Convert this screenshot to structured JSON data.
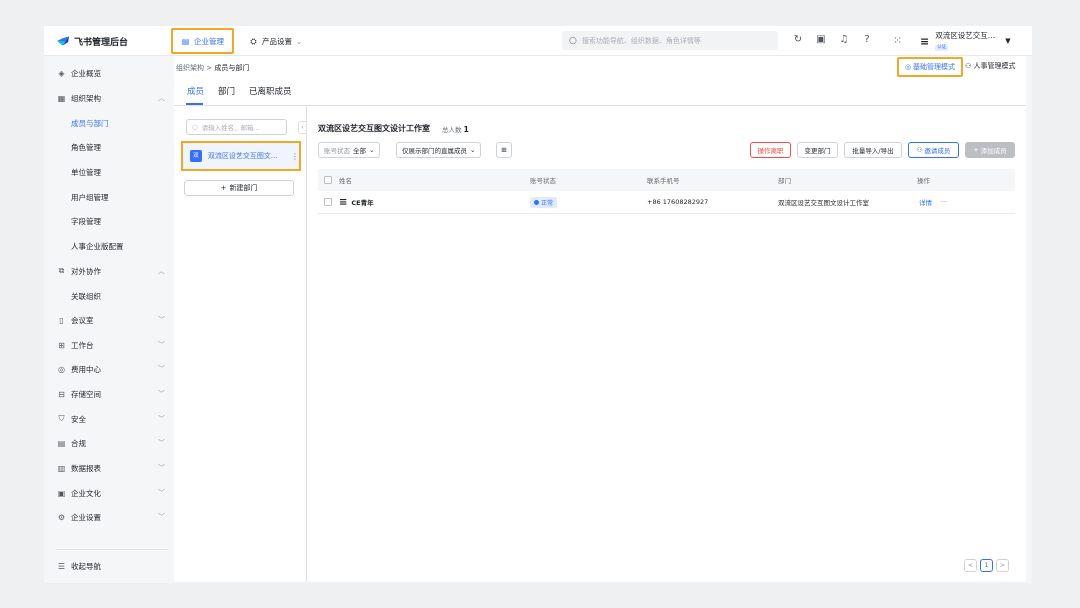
{
  "topbar": {
    "brand": "飞书管理后台",
    "nav_active": "企业管理",
    "nav_product": "产品设置",
    "search_placeholder": "搜索功能导航、组织数据、角色详情等",
    "org_name": "双流区设艺交互…",
    "org_badge": "认证",
    "icons": [
      "refresh-icon",
      "doc-icon",
      "bell-icon",
      "help-icon",
      "apps-grid-icon"
    ]
  },
  "sidebar": {
    "items": [
      {
        "label": "企业概览"
      },
      {
        "label": "组织架构"
      },
      {
        "label": "成员与部门"
      },
      {
        "label": "角色管理"
      },
      {
        "label": "单位管理"
      },
      {
        "label": "用户组管理"
      },
      {
        "label": "字段管理"
      },
      {
        "label": "人事企业版配置"
      },
      {
        "label": "对外协作"
      },
      {
        "label": "关联组织"
      },
      {
        "label": "会议室"
      },
      {
        "label": "工作台"
      },
      {
        "label": "费用中心"
      },
      {
        "label": "存储空间"
      },
      {
        "label": "安全"
      },
      {
        "label": "合规"
      },
      {
        "label": "数据报表"
      },
      {
        "label": "企业文化"
      },
      {
        "label": "企业设置"
      }
    ],
    "collapse_label": "收起导航"
  },
  "breadcrumb": {
    "parent": "组织架构",
    "sep": ">",
    "current": "成员与部门"
  },
  "modes": {
    "basic": "基础管理模式",
    "hr": "人事管理模式"
  },
  "tabs": [
    "成员",
    "部门",
    "已离职成员"
  ],
  "dept_panel": {
    "search_placeholder": "请输入姓名、邮箱...",
    "selected_dept": "双流区设艺交互图文...",
    "dept_avatar": "双",
    "new_dept": "新建部门"
  },
  "content": {
    "title": "双流区设艺交互图文设计工作室",
    "total_label": "总人数",
    "total": "1",
    "filter_status_label": "账号状态",
    "filter_status_value": "全部",
    "filter_direct": "仅展示部门的直属成员",
    "btn_resign": "操作离职",
    "btn_change_dept": "变更部门",
    "btn_batch": "批量导入/导出",
    "btn_invite": "邀请成员",
    "btn_add": "添加成员"
  },
  "table": {
    "headers": [
      "姓名",
      "账号状态",
      "联系手机号",
      "部门",
      "操作"
    ],
    "rows": [
      {
        "name": "CE青年",
        "status": "正常",
        "phone": "+86 17608282927",
        "dept": "双流区设艺交互图文设计工作室",
        "action": "详情",
        "more": "···"
      }
    ]
  },
  "pager": {
    "prev": "<",
    "page": "1",
    "next": ">"
  }
}
